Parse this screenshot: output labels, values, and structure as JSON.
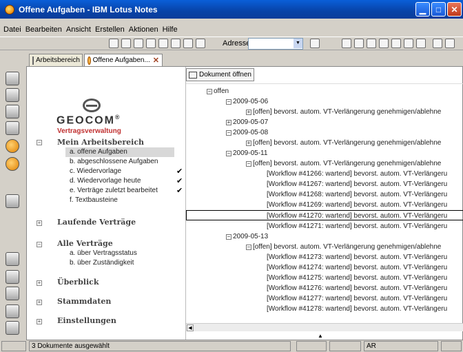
{
  "window": {
    "title": "Offene Aufgaben - IBM Lotus Notes"
  },
  "menu": [
    "Datei",
    "Bearbeiten",
    "Ansicht",
    "Erstellen",
    "Aktionen",
    "Hilfe"
  ],
  "toolbar": {
    "address_label": "Adresse",
    "address_value": ""
  },
  "tabs": [
    {
      "label": "Arbeitsbereich",
      "icon": "workspace-icon"
    },
    {
      "label": "Offene Aufgaben...",
      "icon": "task-icon"
    }
  ],
  "navigator": {
    "logo_text": "GEOCOM",
    "logo_registered": "®",
    "logo_subtitle": "Vertragsverwaltung",
    "sections": [
      {
        "title": "Mein Arbeitsbereich",
        "expanded": true,
        "items": [
          {
            "label": "a. offene Aufgaben",
            "selected": true
          },
          {
            "label": "b. abgeschlossene Aufgaben",
            "checked": true
          },
          {
            "label": "c. Wiedervorlage",
            "checked": true
          },
          {
            "label": "d. Wiedervorlage heute",
            "checked": true
          },
          {
            "label": "e. Verträge zuletzt bearbeitet"
          },
          {
            "label": "f. Textbausteine"
          }
        ]
      },
      {
        "title": "Laufende Verträge",
        "expanded": false
      },
      {
        "title": "Alle Verträge",
        "expanded": true,
        "items": [
          {
            "label": "a. über Vertragsstatus"
          },
          {
            "label": "b. über Zuständigkeit"
          }
        ]
      },
      {
        "title": "Überblick",
        "expanded": false
      },
      {
        "title": "Stammdaten",
        "expanded": false
      },
      {
        "title": "Einstellungen",
        "expanded": false
      }
    ]
  },
  "view": {
    "open_button": "Dokument öffnen",
    "rows": [
      {
        "text": "offen",
        "toggle": "minus"
      },
      {
        "text": "2009-05-06",
        "toggle": "minus"
      },
      {
        "text": "[offen] bevorst. autom. VT-Verlängerung genehmigen/ablehne",
        "toggle": "plus"
      },
      {
        "text": "2009-05-07",
        "toggle": "plus"
      },
      {
        "text": "2009-05-08",
        "toggle": "minus"
      },
      {
        "text": "[offen] bevorst. autom. VT-Verlängerung genehmigen/ablehne",
        "toggle": "plus"
      },
      {
        "text": "2009-05-11",
        "toggle": "minus"
      },
      {
        "text": "[offen] bevorst. autom. VT-Verlängerung genehmigen/ablehne",
        "toggle": "minus"
      },
      {
        "text": "[Workflow #41266: wartend] bevorst. autom. VT-Verlängeru"
      },
      {
        "text": "[Workflow #41267: wartend] bevorst. autom. VT-Verlängeru"
      },
      {
        "text": "[Workflow #41268: wartend] bevorst. autom. VT-Verlängeru"
      },
      {
        "text": "[Workflow #41269: wartend] bevorst. autom. VT-Verlängeru"
      },
      {
        "text": "[Workflow #41270: wartend] bevorst. autom. VT-Verlängeru",
        "focused": true
      },
      {
        "text": "[Workflow #41271: wartend] bevorst. autom. VT-Verlängeru"
      },
      {
        "text": "2009-05-13",
        "toggle": "minus"
      },
      {
        "text": "[offen] bevorst. autom. VT-Verlängerung genehmigen/ablehne",
        "toggle": "minus"
      },
      {
        "text": "[Workflow #41273: wartend] bevorst. autom. VT-Verlängeru"
      },
      {
        "text": "[Workflow #41274: wartend] bevorst. autom. VT-Verlängeru"
      },
      {
        "text": "[Workflow #41275: wartend] bevorst. autom. VT-Verlängeru"
      },
      {
        "text": "[Workflow #41276: wartend] bevorst. autom. VT-Verlängeru"
      },
      {
        "text": "[Workflow #41277: wartend] bevorst. autom. VT-Verlängeru"
      },
      {
        "text": "[Workflow #41278: wartend] bevorst. autom. VT-Verlängeru"
      }
    ]
  },
  "status": {
    "selection": "3 Dokumente ausgewählt",
    "location": "AR"
  }
}
